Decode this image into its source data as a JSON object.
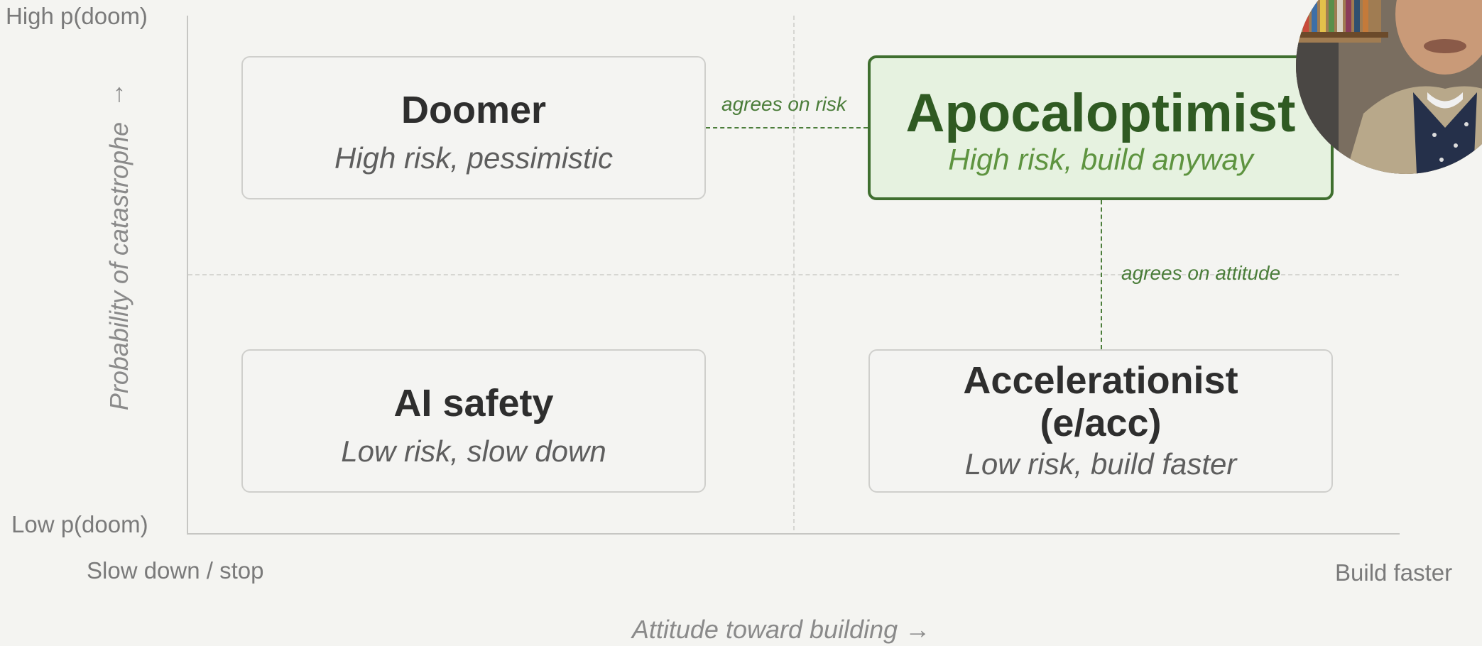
{
  "y_axis": {
    "title": "Probability of catastrophe",
    "arrow": "↑",
    "high_label": "High p(doom)",
    "low_label": "Low p(doom)"
  },
  "x_axis": {
    "title": "Attitude toward building →",
    "left_label": "Slow down / stop",
    "right_label": "Build faster"
  },
  "quadrants": {
    "doomer": {
      "title": "Doomer",
      "subtitle": "High risk, pessimistic"
    },
    "apocaloptimist": {
      "title": "Apocaloptimist",
      "subtitle": "High risk, build anyway"
    },
    "ai_safety": {
      "title": "AI safety",
      "subtitle": "Low risk, slow down"
    },
    "accelerationist": {
      "title_line1": "Accelerationist",
      "title_line2": "(e/acc)",
      "subtitle": "Low risk, build faster"
    }
  },
  "connectors": {
    "risk": "agrees on risk",
    "attitude": "agrees on attitude"
  },
  "colors": {
    "highlight_border": "#3f6f2f",
    "highlight_fill": "#e6f2e0",
    "connector": "#4b7d3a"
  }
}
